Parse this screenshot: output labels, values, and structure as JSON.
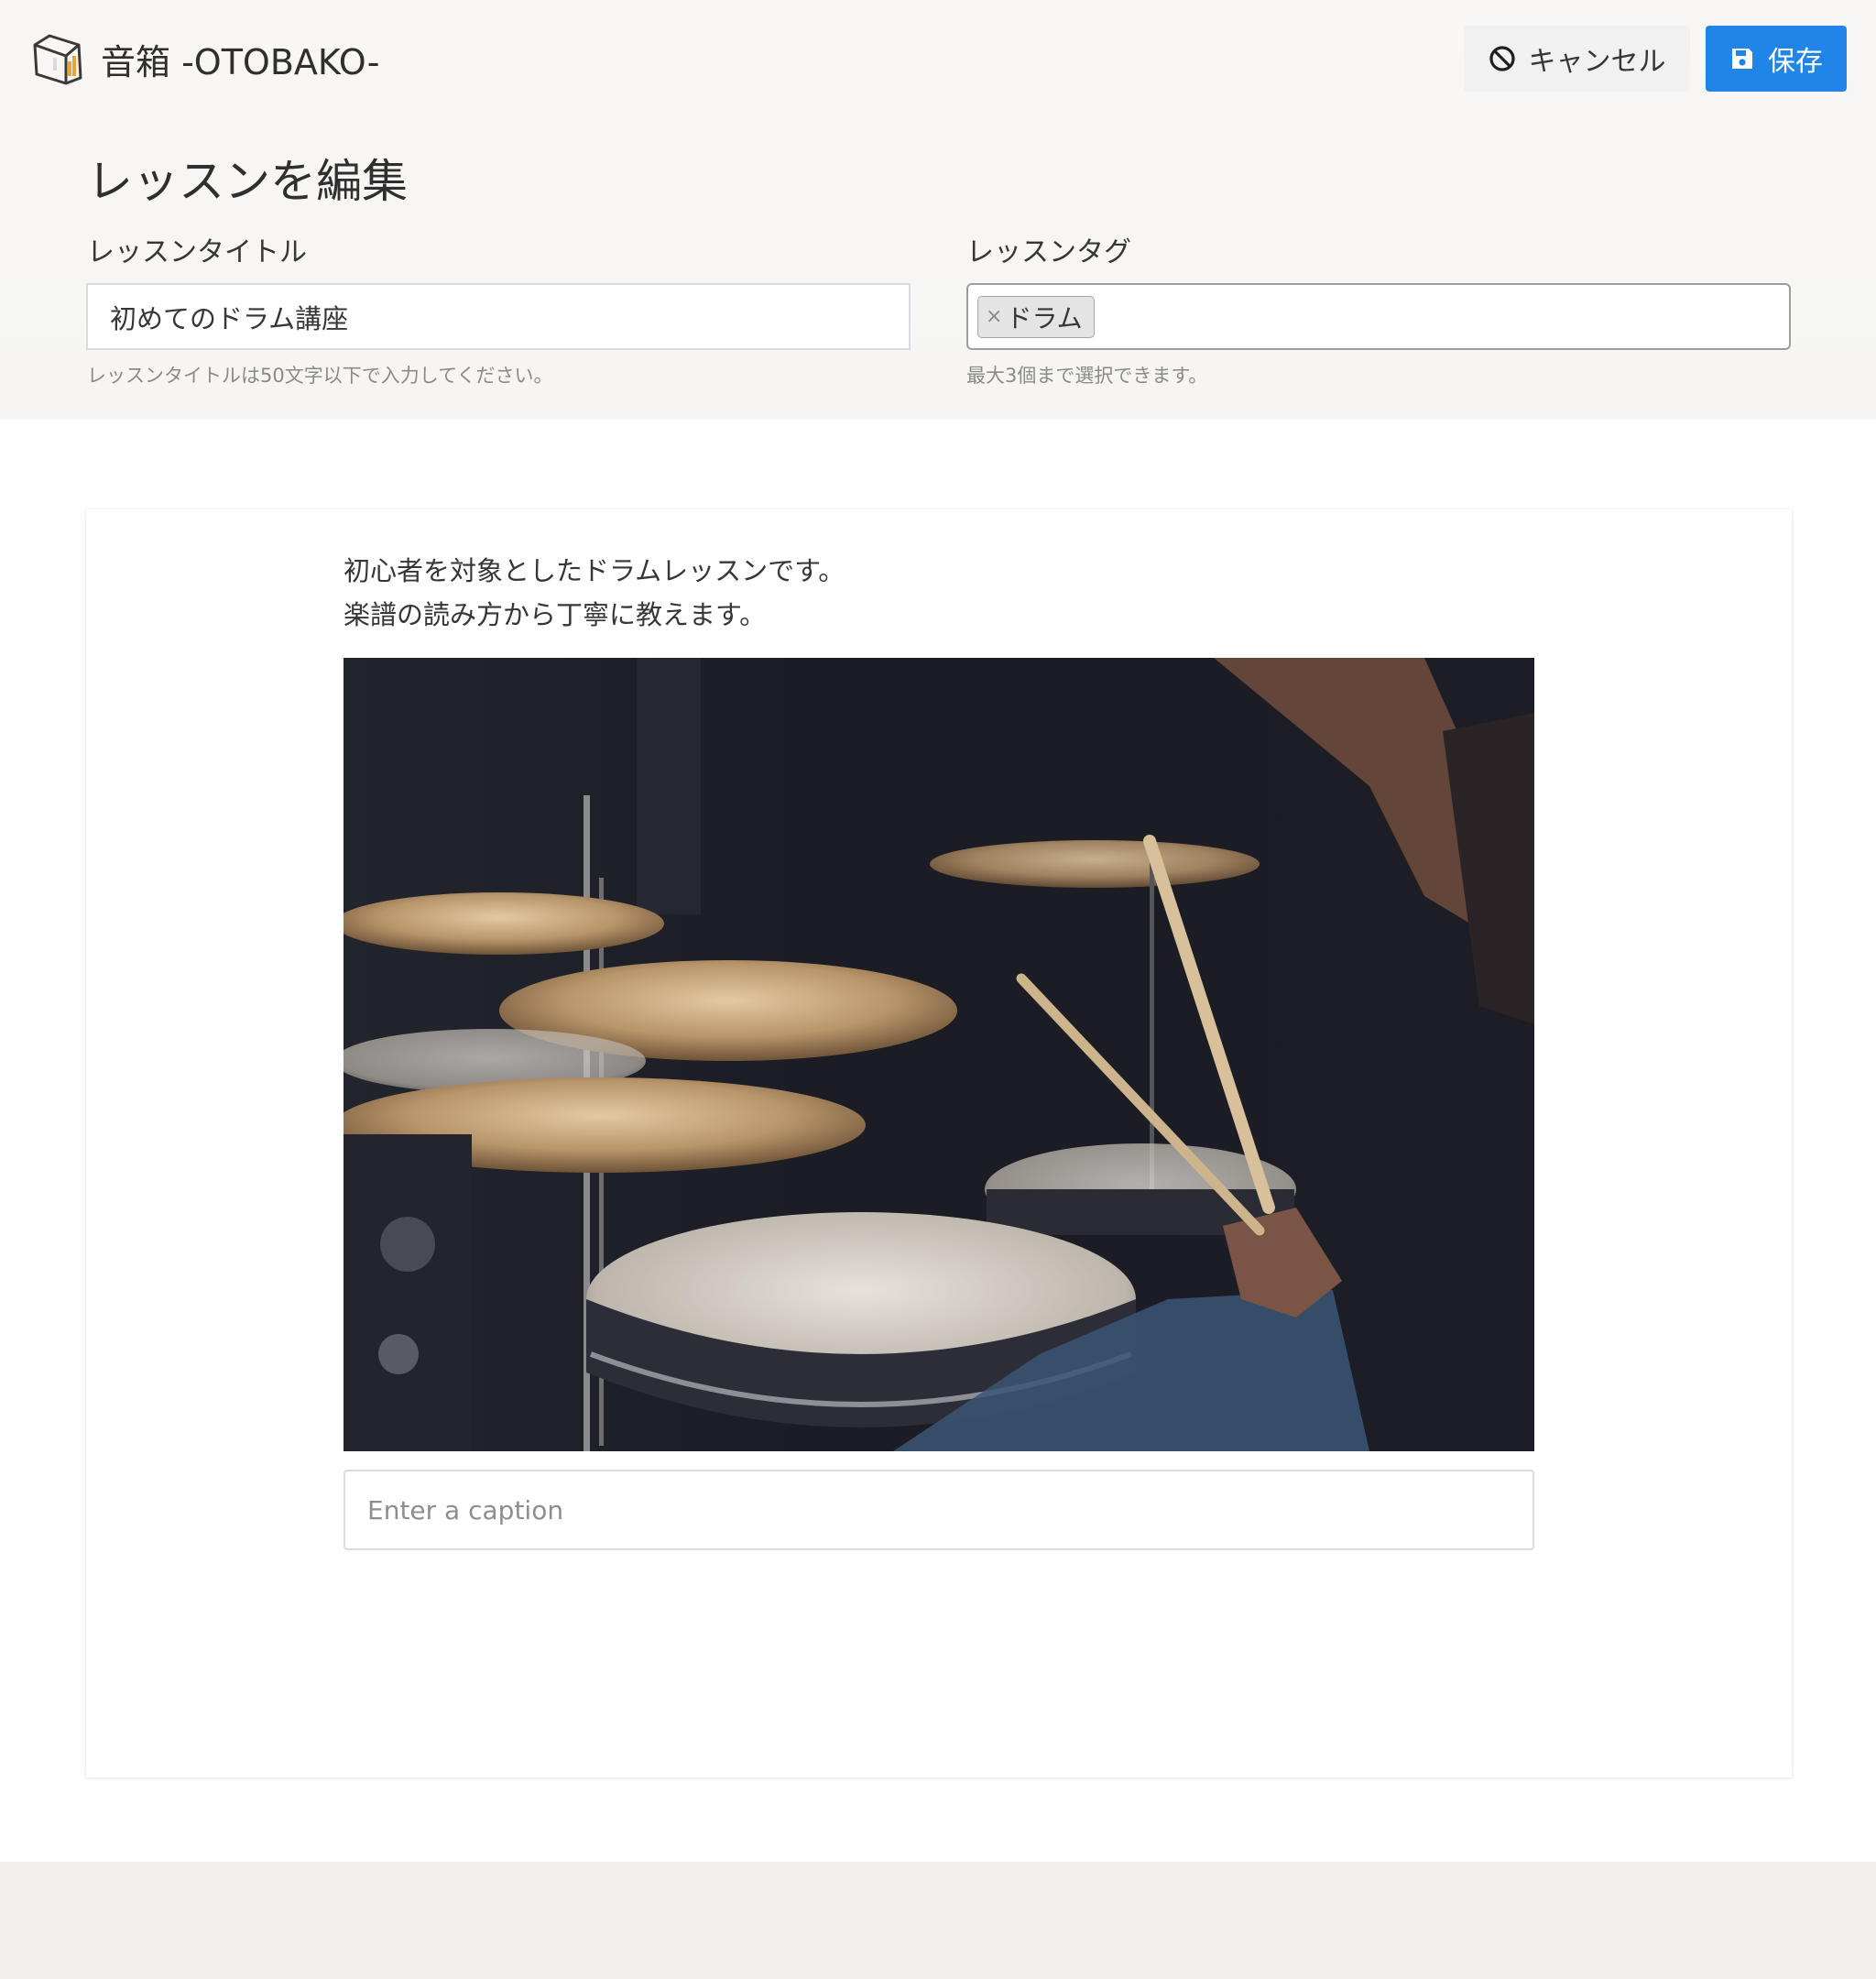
{
  "header": {
    "logo_icon": "otobako-box-logo-icon",
    "app_name": "音箱 -OTOBAKO-",
    "cancel_button": {
      "label": "キャンセル",
      "icon": "ban-circle-icon"
    },
    "save_button": {
      "label": "保存",
      "icon": "floppy-disk-icon",
      "color": "#2185e8"
    }
  },
  "form": {
    "page_title": "レッスンを編集",
    "title_field": {
      "label": "レッスンタイトル",
      "value": "初めてのドラム講座",
      "help": "レッスンタイトルは50文字以下で入力してください。"
    },
    "tags_field": {
      "label": "レッスンタグ",
      "tags": [
        {
          "remove": "×",
          "label": "ドラム"
        }
      ],
      "help": "最大3個まで選択できます。"
    }
  },
  "editor": {
    "paragraphs": [
      "初心者を対象としたドラムレッスンです。",
      "楽譜の読み方から丁寧に教えます。"
    ],
    "image": {
      "subject": "drummer playing a drum kit with cymbals"
    },
    "caption": {
      "value": "",
      "placeholder": "Enter a caption"
    }
  }
}
